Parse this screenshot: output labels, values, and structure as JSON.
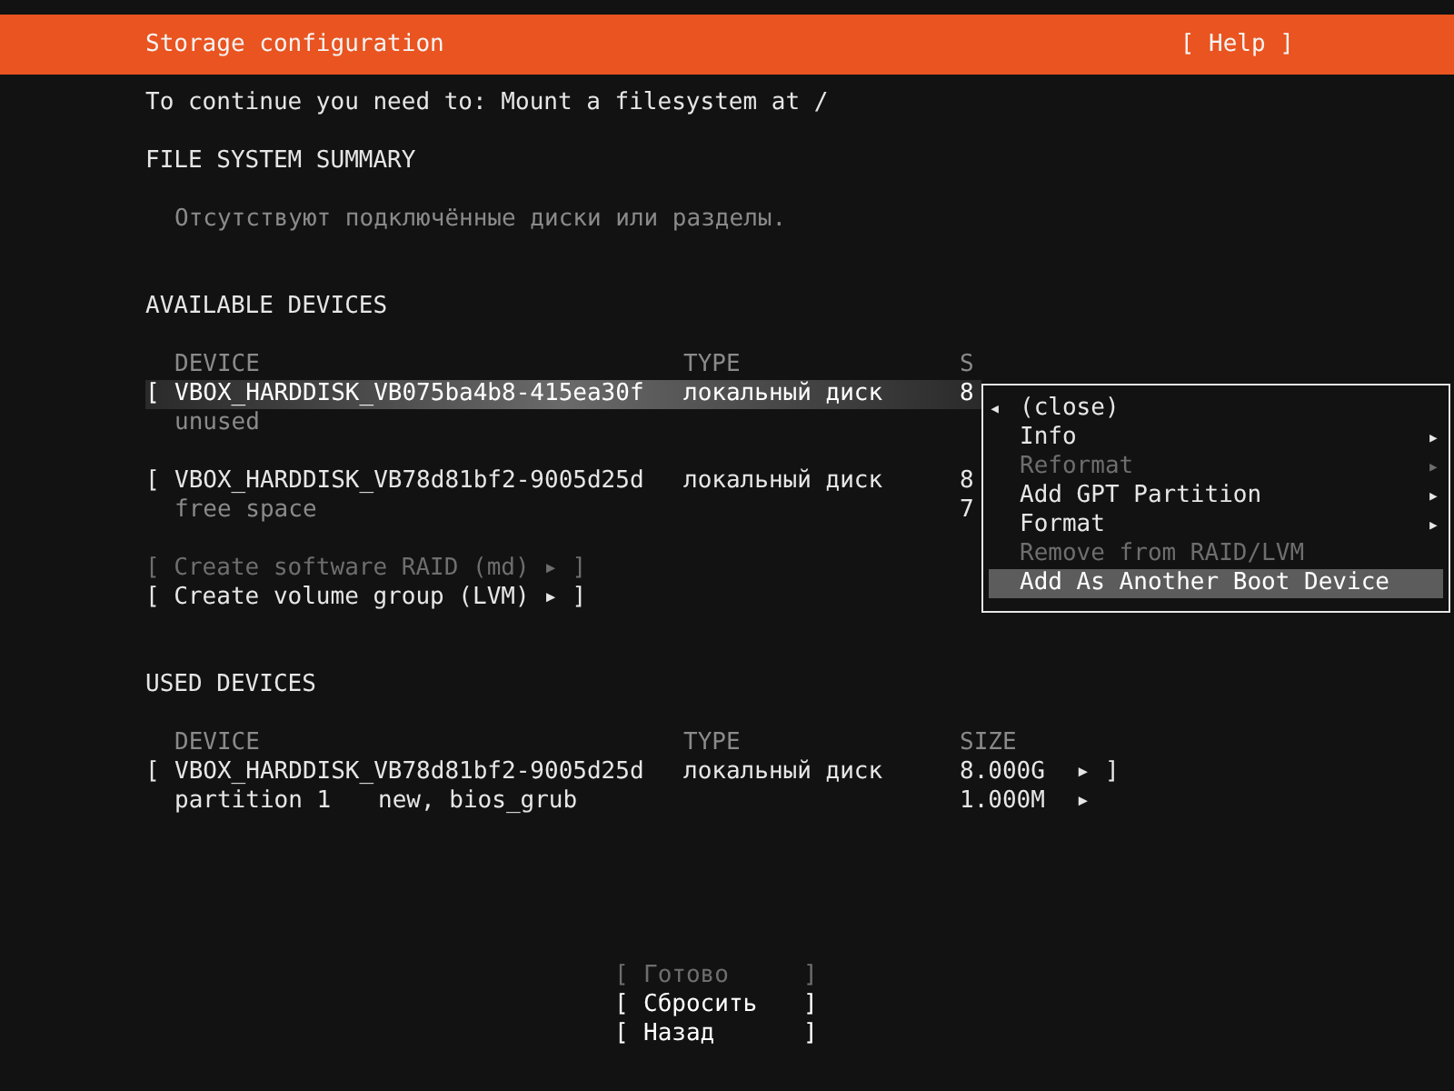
{
  "header": {
    "title": "Storage configuration",
    "help": "[ Help ]"
  },
  "instruction": "To continue you need to: Mount a filesystem at /",
  "summary": {
    "heading": "FILE SYSTEM SUMMARY",
    "message": "Отсутствуют подключённые диски или разделы."
  },
  "available": {
    "heading": "AVAILABLE DEVICES",
    "columns": [
      "DEVICE",
      "TYPE",
      "S"
    ],
    "devices": [
      {
        "open": "[",
        "name": "VBOX_HARDDISK_VB075ba4b8-415ea30f",
        "type": "локальный диск",
        "size": "8",
        "selected": true,
        "detail": "unused"
      },
      {
        "open": "[",
        "name": "VBOX_HARDDISK_VB78d81bf2-9005d25d",
        "type": "локальный диск",
        "size": "8",
        "selected": false,
        "detail": "free space",
        "detail_size": "7"
      }
    ],
    "actions": [
      {
        "open": "[",
        "label": "Create software RAID (md)",
        "arrow": "▸",
        "close": "]",
        "disabled": true
      },
      {
        "open": "[",
        "label": "Create volume group (LVM)",
        "arrow": "▸",
        "close": "]",
        "disabled": false
      }
    ]
  },
  "menu": {
    "items": [
      {
        "kind": "close",
        "glyph": "◂",
        "label": "(close)",
        "disabled": false,
        "selected": false
      },
      {
        "kind": "submenu",
        "label": "Info",
        "arrow": "▸",
        "disabled": false,
        "selected": false
      },
      {
        "kind": "submenu",
        "label": "Reformat",
        "arrow": "▸",
        "disabled": true,
        "selected": false
      },
      {
        "kind": "submenu",
        "label": "Add GPT Partition",
        "arrow": "▸",
        "disabled": false,
        "selected": false
      },
      {
        "kind": "submenu",
        "label": "Format",
        "arrow": "▸",
        "disabled": false,
        "selected": false
      },
      {
        "kind": "action",
        "label": "Remove from RAID/LVM",
        "disabled": true,
        "selected": false
      },
      {
        "kind": "action",
        "label": "Add As Another Boot Device",
        "disabled": false,
        "selected": true
      }
    ]
  },
  "used": {
    "heading": "USED DEVICES",
    "columns": [
      "DEVICE",
      "TYPE",
      "SIZE"
    ],
    "rows": [
      {
        "kind": "disk",
        "open": "[",
        "name": "VBOX_HARDDISK_VB78d81bf2-9005d25d",
        "type": "локальный диск",
        "size": "8.000G",
        "arrow": "▸",
        "close": "]"
      },
      {
        "kind": "partition",
        "name": "partition 1",
        "type": "new, bios_grub",
        "size": "1.000M",
        "arrow": "▸"
      }
    ]
  },
  "buttons": [
    {
      "open": "[",
      "label": "Готово",
      "close": "]",
      "disabled": true
    },
    {
      "open": "[",
      "label": "Сбросить",
      "close": "]",
      "disabled": false
    },
    {
      "open": "[",
      "label": "Назад",
      "close": "]",
      "disabled": false
    }
  ]
}
